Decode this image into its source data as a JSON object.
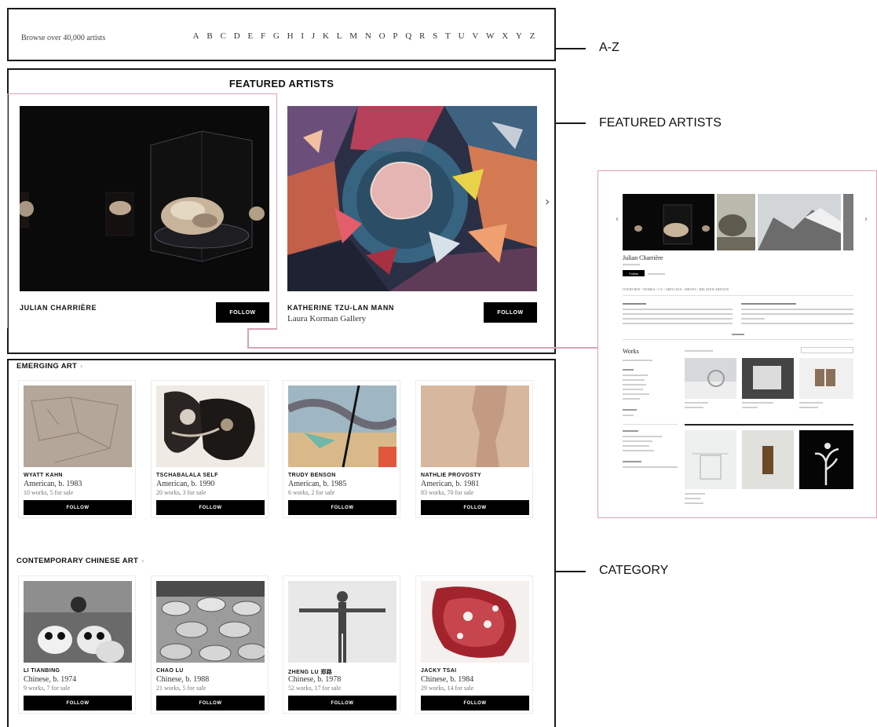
{
  "az": {
    "browse_text": "Browse over 40,000 artists",
    "letters": [
      "A",
      "B",
      "C",
      "D",
      "E",
      "F",
      "G",
      "H",
      "I",
      "J",
      "K",
      "L",
      "M",
      "N",
      "O",
      "P",
      "Q",
      "R",
      "S",
      "T",
      "U",
      "V",
      "W",
      "X",
      "Y",
      "Z"
    ]
  },
  "callouts": {
    "az": "A-Z",
    "featured": "FEATURED ARTISTS",
    "category": "CATEGORY"
  },
  "featured": {
    "title": "FEATURED ARTISTS",
    "artists": [
      {
        "name": "JULIAN CHARRIÈRE",
        "gallery": "",
        "follow_label": "FOLLOW"
      },
      {
        "name": "KATHERINE TZU-LAN MANN",
        "gallery": "Laura Korman Gallery",
        "follow_label": "FOLLOW"
      }
    ],
    "next_icon": "chevron-right-icon"
  },
  "categories": [
    {
      "title": "EMERGING ART",
      "artists": [
        {
          "name": "WYATT KAHN",
          "nationality": "American, b. 1983",
          "works": "10 works, 5 for sale",
          "follow_label": "FOLLOW"
        },
        {
          "name": "TSCHABALALA SELF",
          "nationality": "American, b. 1990",
          "works": "20 works, 3 for sale",
          "follow_label": "FOLLOW"
        },
        {
          "name": "TRUDY BENSON",
          "nationality": "American, b. 1985",
          "works": "6 works, 2 for sale",
          "follow_label": "FOLLOW"
        },
        {
          "name": "NATHLIE PROVOSTY",
          "nationality": "American, b. 1981",
          "works": "83 works, 70 for sale",
          "follow_label": "FOLLOW"
        }
      ]
    },
    {
      "title": "CONTEMPORARY CHINESE ART",
      "artists": [
        {
          "name": "LI TIANBING",
          "nationality": "Chinese, b. 1974",
          "works": "9 works, 7 for sale",
          "follow_label": "FOLLOW"
        },
        {
          "name": "CHAO LU",
          "nationality": "Chinese, b. 1988",
          "works": "21 works, 5 for sale",
          "follow_label": "FOLLOW"
        },
        {
          "name": "ZHENG LU 郑路",
          "nationality": "Chinese, b. 1978",
          "works": "52 works, 17 for sale",
          "follow_label": "FOLLOW"
        },
        {
          "name": "JACKY TSAI",
          "nationality": "Chinese, b. 1984",
          "works": "29 works, 14 for sale",
          "follow_label": "FOLLOW"
        }
      ]
    }
  ],
  "detail": {
    "artist_name": "Julian Charrière",
    "follow_label": "Follow",
    "tabs": "OVERVIEW / WORKS / CV / ARTICLES / SHOWS / RELATED ARTISTS",
    "works_title": "Works"
  }
}
